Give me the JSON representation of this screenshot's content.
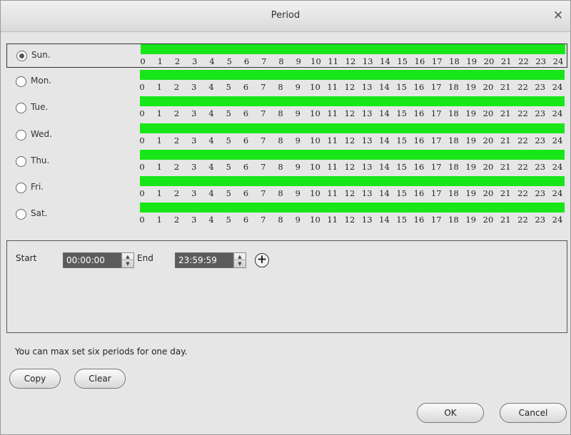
{
  "window": {
    "title": "Period",
    "close_glyph": "✕"
  },
  "days": [
    {
      "label": "Sun.",
      "selected": true
    },
    {
      "label": "Mon.",
      "selected": false
    },
    {
      "label": "Tue.",
      "selected": false
    },
    {
      "label": "Wed.",
      "selected": false
    },
    {
      "label": "Thu.",
      "selected": false
    },
    {
      "label": "Fri.",
      "selected": false
    },
    {
      "label": "Sat.",
      "selected": false
    }
  ],
  "timeline": {
    "hour_labels": [
      "0",
      "1",
      "2",
      "3",
      "4",
      "5",
      "6",
      "7",
      "8",
      "9",
      "10",
      "11",
      "12",
      "13",
      "14",
      "15",
      "16",
      "17",
      "18",
      "19",
      "20",
      "21",
      "22",
      "23",
      "24"
    ],
    "bar_color": "#19e619",
    "coverage_start_hour": 0,
    "coverage_end_hour": 24
  },
  "period": {
    "start_label": "Start",
    "start_value": "00:00:00",
    "end_label": "End",
    "end_value": "23:59:59",
    "add_glyph": "+"
  },
  "hint": "You can max set six periods for one day.",
  "buttons": {
    "copy": "Copy",
    "clear": "Clear",
    "ok": "OK",
    "cancel": "Cancel"
  },
  "icons": {
    "radio": "radio-icon",
    "close": "close-icon",
    "add": "plus-circle-icon",
    "spinner_up": "triangle-up-icon",
    "spinner_down": "triangle-down-icon"
  }
}
